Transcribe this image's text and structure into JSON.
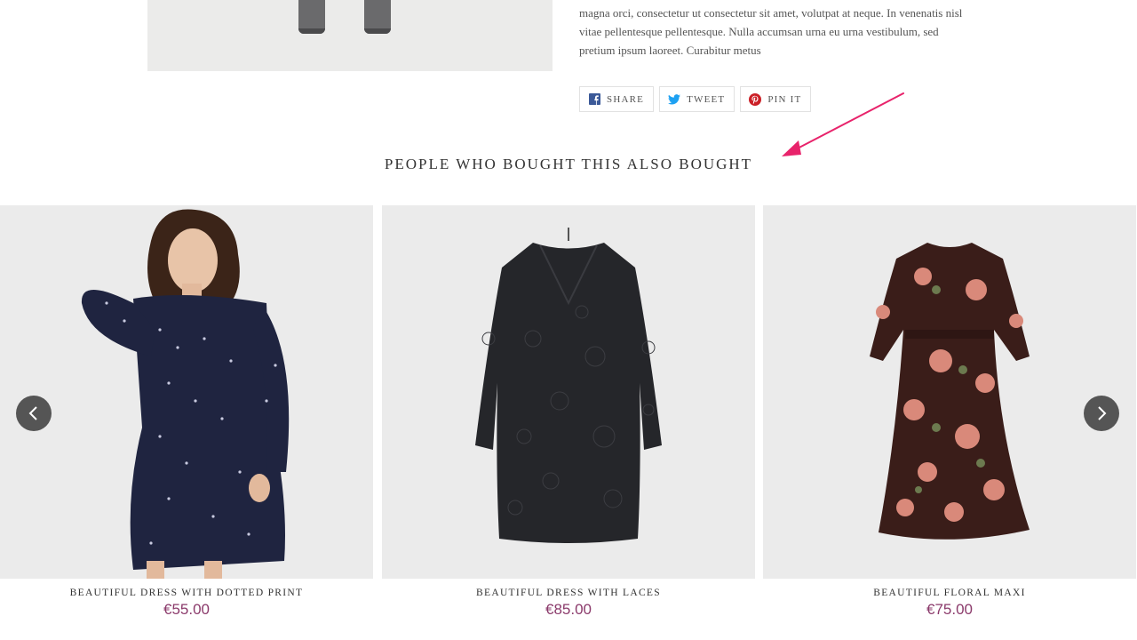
{
  "description": {
    "line_top": "magna orci, consectetur ut consectetur sit amet, volutpat at neque. In venenatis nisl",
    "line_2": "vitae pellentesque pellentesque. Nulla accumsan urna eu urna vestibulum, sed",
    "line_3": "pretium ipsum laoreet. Curabitur metus"
  },
  "share": {
    "facebook_label": "SHARE",
    "twitter_label": "TWEET",
    "pinterest_label": "PIN IT"
  },
  "section": {
    "title": "PEOPLE WHO BOUGHT THIS ALSO BOUGHT"
  },
  "products": [
    {
      "name": "BEAUTIFUL DRESS WITH DOTTED PRINT",
      "price": "€55.00"
    },
    {
      "name": "BEAUTIFUL DRESS WITH LACES",
      "price": "€85.00"
    },
    {
      "name": "BEAUTIFUL FLORAL MAXI",
      "price": "€75.00"
    }
  ],
  "colors": {
    "price": "#8b3a6b",
    "arrow": "#e8236b",
    "nav_button": "#555555"
  }
}
